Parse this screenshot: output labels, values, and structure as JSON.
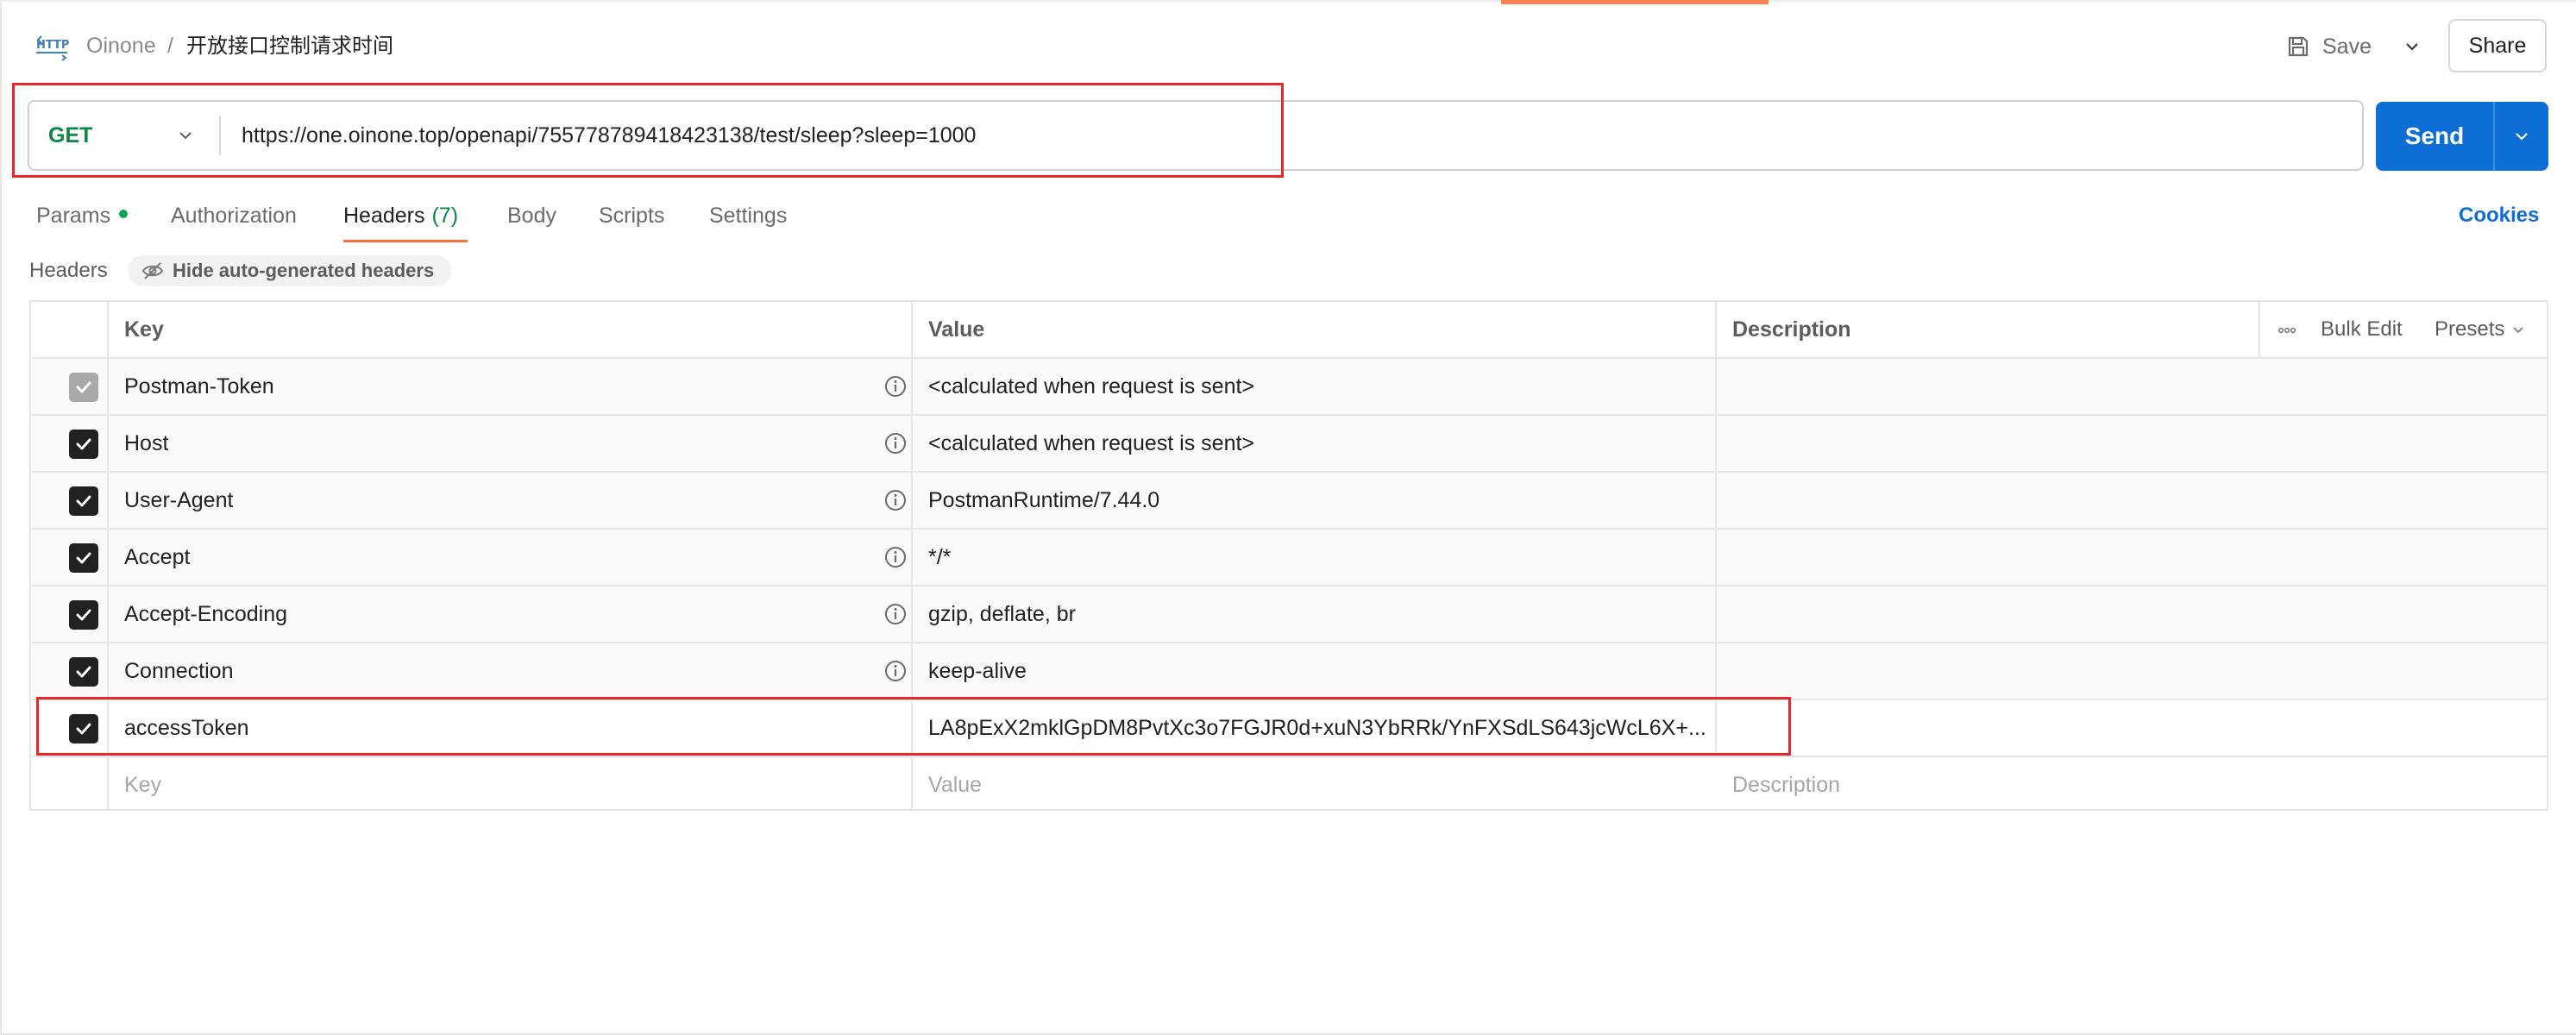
{
  "header": {
    "icon": "http-icon",
    "breadcrumb_parent": "Oinone",
    "breadcrumb_separator": "/",
    "title": "开放接口控制请求时间",
    "save_label": "Save",
    "share_label": "Share"
  },
  "request": {
    "method": "GET",
    "url": "https://one.oinone.top/openapi/755778789418423138/test/sleep?sleep=1000",
    "send_label": "Send"
  },
  "tabs": [
    {
      "label": "Params",
      "has_dot": true
    },
    {
      "label": "Authorization"
    },
    {
      "label": "Headers",
      "count": "(7)",
      "active": true
    },
    {
      "label": "Body"
    },
    {
      "label": "Scripts"
    },
    {
      "label": "Settings"
    }
  ],
  "cookies_label": "Cookies",
  "headers_section": {
    "label": "Headers",
    "hide_auto_label": "Hide auto-generated headers"
  },
  "table": {
    "columns": {
      "key": "Key",
      "value": "Value",
      "description": "Description",
      "bulk_edit": "Bulk Edit",
      "presets": "Presets"
    },
    "rows": [
      {
        "key": "Postman-Token",
        "value": "<calculated when request is sent>",
        "checked": true,
        "auto": true,
        "disabled": true
      },
      {
        "key": "Host",
        "value": "<calculated when request is sent>",
        "checked": true,
        "auto": true
      },
      {
        "key": "User-Agent",
        "value": "PostmanRuntime/7.44.0",
        "checked": true,
        "auto": true
      },
      {
        "key": "Accept",
        "value": "*/*",
        "checked": true,
        "auto": true
      },
      {
        "key": "Accept-Encoding",
        "value": "gzip, deflate, br",
        "checked": true,
        "auto": true
      },
      {
        "key": "Connection",
        "value": "keep-alive",
        "checked": true,
        "auto": true
      },
      {
        "key": "accessToken",
        "value": "LA8pExX2mklGpDM8PvtXc3o7FGJR0d+xuN3YbRRk/YnFXSdLS643jcWcL6X+...",
        "checked": true,
        "auto": false
      }
    ],
    "new_row": {
      "key_placeholder": "Key",
      "value_placeholder": "Value",
      "description_placeholder": "Description"
    }
  },
  "colors": {
    "accent": "#ff6c37",
    "send": "#0d6fd6",
    "method": "#0a8744",
    "highlight": "#e8272b"
  }
}
